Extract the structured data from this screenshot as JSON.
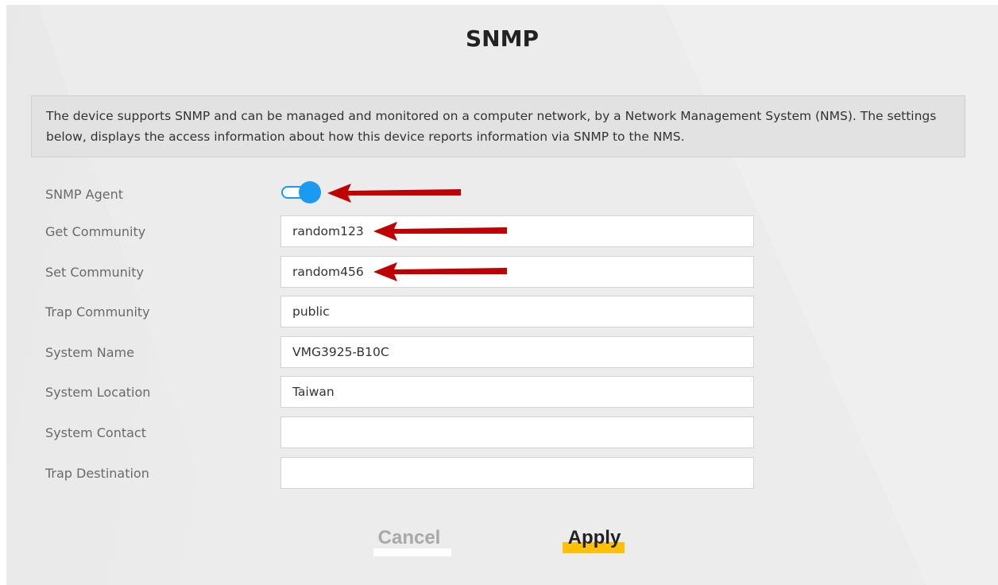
{
  "page": {
    "title": "SNMP",
    "description": "The device supports SNMP and can be managed and monitored on a computer network, by a Network Management System (NMS). The settings below, displays the access information about how this device reports information via SNMP to the NMS."
  },
  "form": {
    "snmp_agent": {
      "label": "SNMP Agent",
      "enabled": true
    },
    "get_community": {
      "label": "Get Community",
      "value": "random123"
    },
    "set_community": {
      "label": "Set Community",
      "value": "random456"
    },
    "trap_community": {
      "label": "Trap Community",
      "value": "public"
    },
    "system_name": {
      "label": "System Name",
      "value": "VMG3925-B10C"
    },
    "system_location": {
      "label": "System Location",
      "value": "Taiwan"
    },
    "system_contact": {
      "label": "System Contact",
      "value": ""
    },
    "trap_destination": {
      "label": "Trap Destination",
      "value": ""
    }
  },
  "buttons": {
    "cancel": "Cancel",
    "apply": "Apply"
  },
  "colors": {
    "accent": "#1a9af1",
    "annotation_arrow": "#c00000",
    "apply_highlight": "#ffc107"
  }
}
